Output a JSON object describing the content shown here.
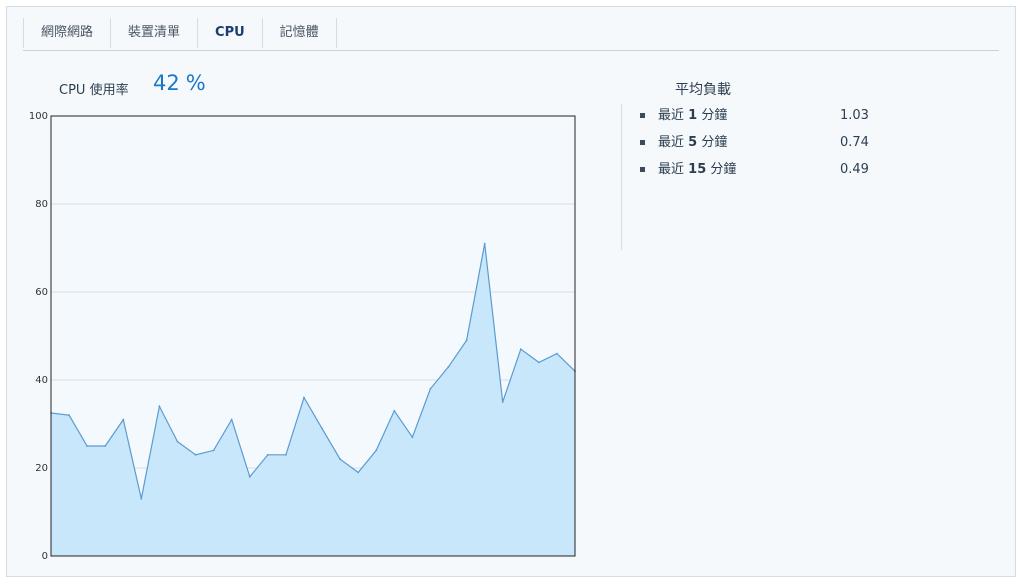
{
  "tabs": [
    {
      "label": "網際網路"
    },
    {
      "label": "裝置清單"
    },
    {
      "label": "CPU"
    },
    {
      "label": "記憶體"
    }
  ],
  "active_tab": 2,
  "cpu": {
    "label": "CPU 使用率",
    "value": "42",
    "unit": "%"
  },
  "load_average": {
    "title": "平均負載",
    "items": [
      {
        "prefix": "最近",
        "num": "1",
        "suffix": "分鐘",
        "value": "1.03"
      },
      {
        "prefix": "最近",
        "num": "5",
        "suffix": "分鐘",
        "value": "0.74"
      },
      {
        "prefix": "最近",
        "num": "15",
        "suffix": "分鐘",
        "value": "0.49"
      }
    ]
  },
  "chart_data": {
    "type": "area",
    "title": "",
    "xlabel": "",
    "ylabel": "",
    "ylim": [
      0,
      100
    ],
    "yticks": [
      0,
      20,
      40,
      60,
      80,
      100
    ],
    "grid": true,
    "values": [
      32.5,
      32,
      25,
      25,
      31,
      13,
      34,
      26,
      23,
      24,
      31,
      18,
      23,
      23,
      36,
      29,
      22,
      19,
      24,
      33,
      27,
      38,
      43,
      49,
      71,
      35,
      47,
      44,
      46,
      42
    ],
    "colors": {
      "fill": "#c9e7fb",
      "line": "#5b9bd0",
      "plot_bg": "#f4f9fe",
      "grid": "#d8dde2",
      "frame": "#222222"
    }
  }
}
